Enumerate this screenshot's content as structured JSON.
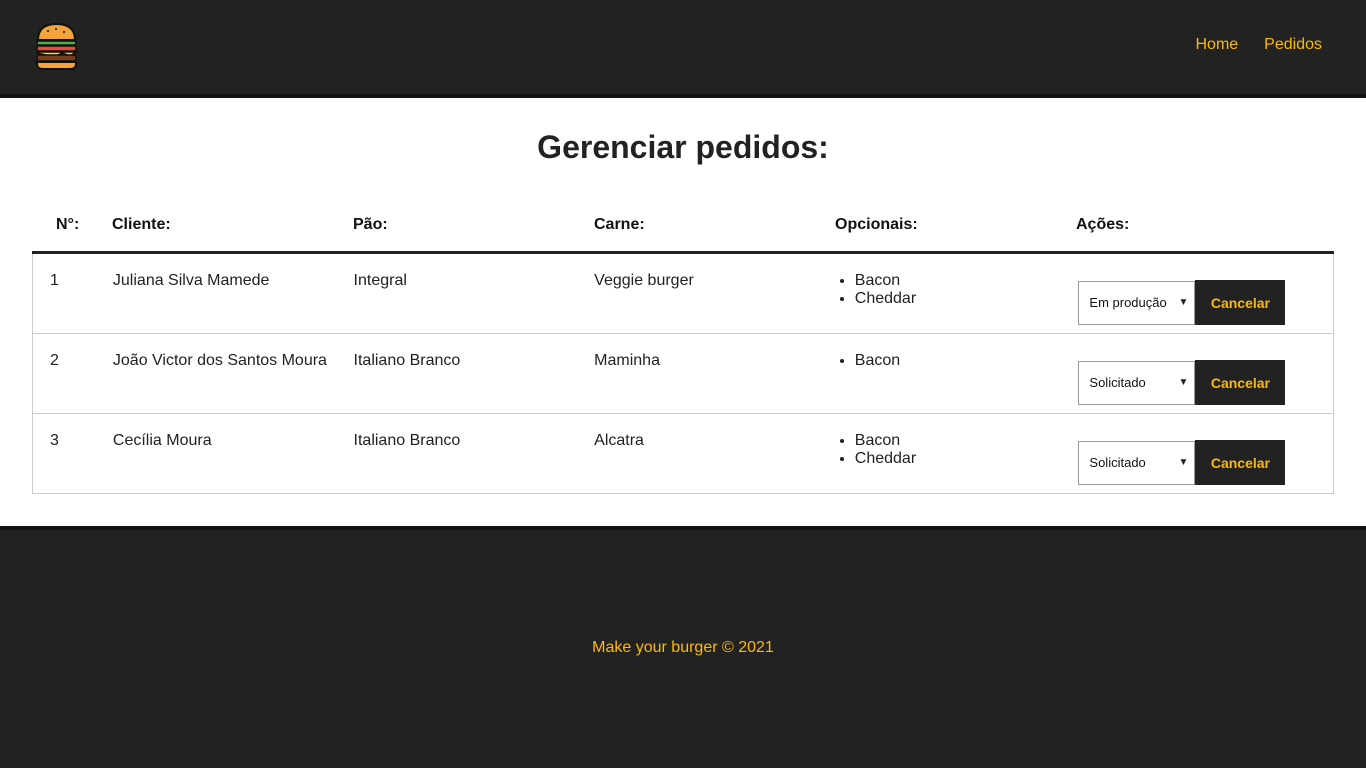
{
  "brand": {
    "logo_icon": "burger-icon",
    "accent": "#fcba03",
    "dark": "#222222"
  },
  "nav": {
    "home": "Home",
    "orders": "Pedidos"
  },
  "page": {
    "title": "Gerenciar pedidos:"
  },
  "table": {
    "headers": [
      "N°:",
      "Cliente:",
      "Pão:",
      "Carne:",
      "Opcionais:",
      "Ações:"
    ],
    "rows": [
      {
        "id": "1",
        "client": "Juliana Silva Mamede",
        "bread": "Integral",
        "meat": "Veggie burger",
        "options": [
          "Bacon",
          "Cheddar"
        ],
        "status": "Em produção",
        "action": "Cancelar"
      },
      {
        "id": "2",
        "client": "João Victor dos Santos Moura",
        "bread": "Italiano Branco",
        "meat": "Maminha",
        "options": [
          "Bacon"
        ],
        "status": "Solicitado",
        "action": "Cancelar"
      },
      {
        "id": "3",
        "client": "Cecília Moura",
        "bread": "Italiano Branco",
        "meat": "Alcatra",
        "options": [
          "Bacon",
          "Cheddar"
        ],
        "status": "Solicitado",
        "action": "Cancelar"
      }
    ]
  },
  "footer": {
    "text": "Make your burger © 2021"
  }
}
